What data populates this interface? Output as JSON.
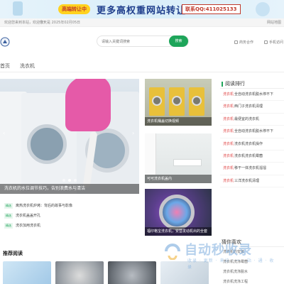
{
  "banner": {
    "badge": "高端转让中",
    "headline": "更多高权重网站转让",
    "contact": "联系QQ:411025133"
  },
  "notice": {
    "left": "欢迎您来到本站，欢迎您！",
    "date": "今天是 2025年02月05日",
    "right": "网站地图"
  },
  "search": {
    "placeholder": "请输入关键词搜索",
    "button": "搜索"
  },
  "header_links": {
    "business": "商务合作",
    "mobile": "手机访问"
  },
  "nav": {
    "items": [
      "首页",
      "洗衣机"
    ]
  },
  "hero": {
    "caption": "洗衣机的水位调节技巧，告别浪费水与清洁"
  },
  "hero_list": [
    {
      "tag": "精选",
      "text": "离热洗衣机炉烤：背后的故事与影像"
    },
    {
      "tag": "精选",
      "text": "洗衣机盖盖开孔"
    },
    {
      "tag": "精选",
      "text": "洗衣加用洗衣机"
    }
  ],
  "mid_items": [
    {
      "caption": "洗衣机桶盖切换视频"
    },
    {
      "caption": "可可洗衣机盖内"
    },
    {
      "caption": "福印格宝洗衣机，安营发动机出的全套"
    }
  ],
  "sidebar": {
    "title": "阅读排行",
    "items": [
      {
        "k": "洗衣机",
        "text": "全自动洗衣机脱水停不下"
      },
      {
        "k": "洗衣机",
        "text": "西门子洗衣机清理"
      },
      {
        "k": "洗衣机",
        "text": "最便宜的洗衣机"
      },
      {
        "k": "洗衣机",
        "text": "全自动洗衣机脱水停不下"
      },
      {
        "k": "洗衣机",
        "text": "洗衣机洗衣机操作"
      },
      {
        "k": "洗衣机",
        "text": "洗衣机洗衣机霉菌"
      },
      {
        "k": "洗衣机",
        "text": "移干一体洗衣机溜溜"
      },
      {
        "k": "洗衣机",
        "text": "三洋洗衣机清理"
      }
    ]
  },
  "recommended": {
    "title": "推荐阅读"
  },
  "sidebar2": {
    "title": "猜你喜欢",
    "items": [
      "洗衣机的安装",
      "洗衣机洗涤霉菌",
      "洗衣机洗涤脱水",
      "洗衣机洗涤工程"
    ]
  },
  "watermark": {
    "title": "自动秒收录",
    "sub": "收录 · 更新 · 来访 · 一 · 站 · 通 · 收录"
  }
}
